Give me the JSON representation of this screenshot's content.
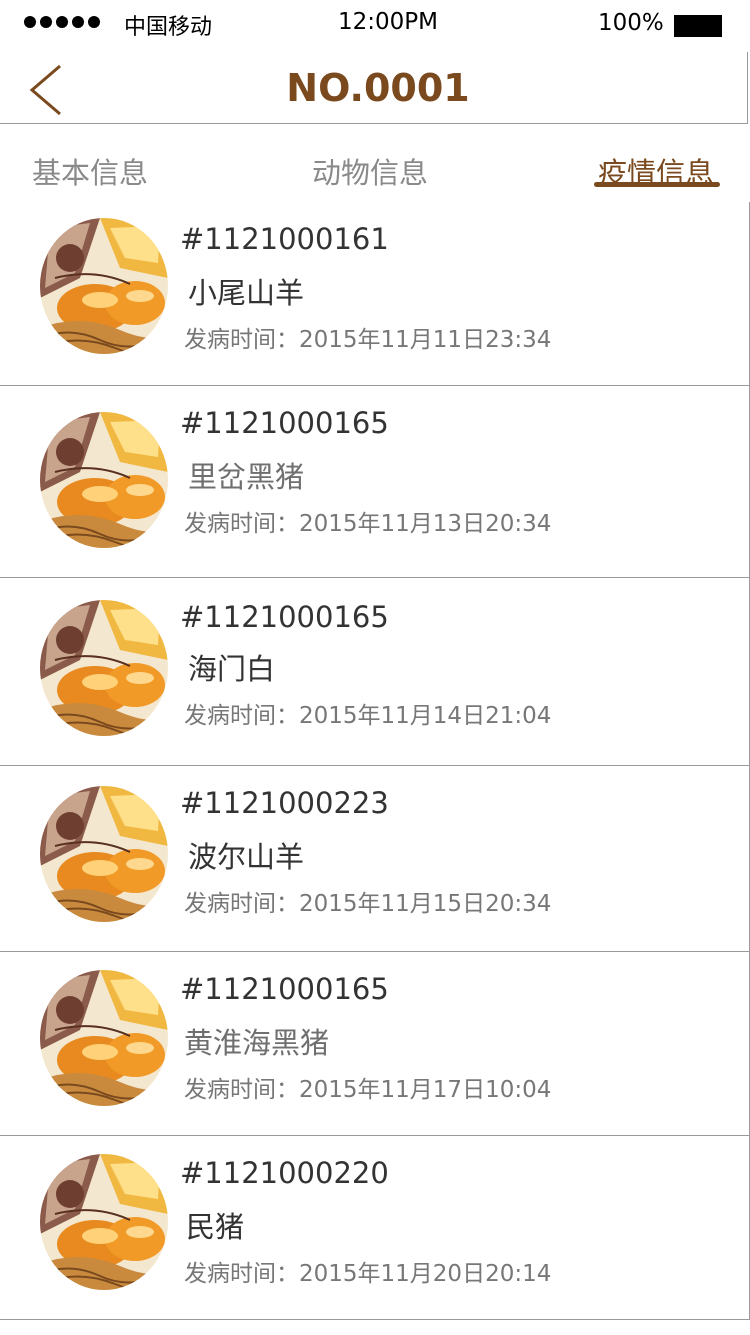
{
  "status_bar": {
    "carrier": "中国移动",
    "time": "12:00PM",
    "battery": "100%"
  },
  "nav": {
    "title": "NO.0001",
    "back_icon": "chevron-left-icon"
  },
  "tabs": [
    {
      "label": "基本信息",
      "active": false
    },
    {
      "label": "动物信息",
      "active": false
    },
    {
      "label": "疫情信息",
      "active": true
    }
  ],
  "colors": {
    "accent": "#7a4a1e",
    "inactive_tab": "#8a8a8a",
    "divider": "#999999"
  },
  "records": [
    {
      "code": "#1121000161",
      "breed": "小尾山羊",
      "time_label": "发病时间：",
      "time": "2015年11月11日23:34"
    },
    {
      "code": "#1121000165",
      "breed": "里岔黑猪",
      "time_label": "发病时间：",
      "time": "2015年11月13日20:34"
    },
    {
      "code": "#1121000165",
      "breed": "海门白",
      "time_label": "发病时间：",
      "time": "2015年11月14日21:04"
    },
    {
      "code": "#1121000223",
      "breed": "波尔山羊",
      "time_label": "发病时间：",
      "time": "2015年11月15日20:34"
    },
    {
      "code": "#1121000165",
      "breed": "黄淮海黑猪",
      "time_label": "发病时间：",
      "time": "2015年11月17日10:04"
    },
    {
      "code": "#1121000220",
      "breed": "民猪",
      "time_label": "发病时间：",
      "time": "2015年11月20日20:14"
    }
  ]
}
